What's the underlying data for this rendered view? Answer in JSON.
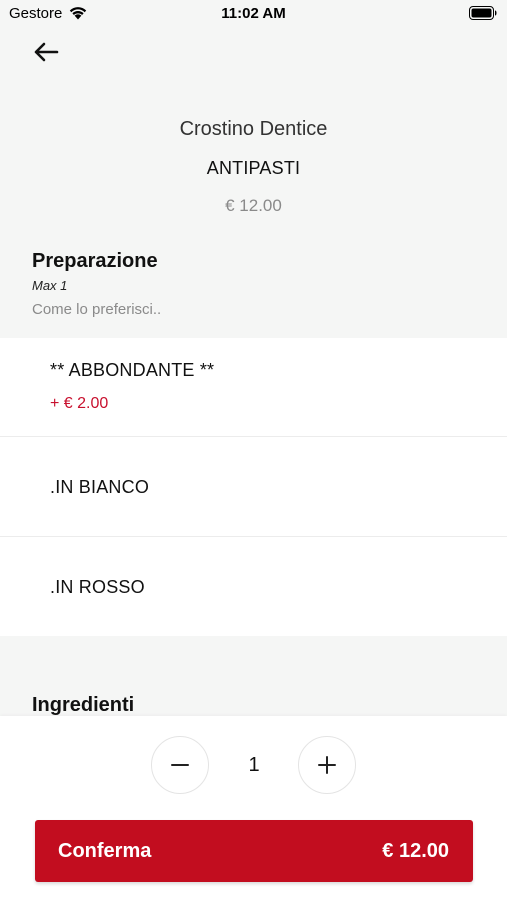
{
  "status_bar": {
    "carrier": "Gestore",
    "time": "11:02 AM",
    "icons": [
      "wifi-icon",
      "battery-icon"
    ]
  },
  "navigation": {
    "back_icon": "arrow-left-icon"
  },
  "product": {
    "name": "Crostino Dentice",
    "category": "ANTIPASTI",
    "price": "€ 12.00"
  },
  "preparation": {
    "title": "Preparazione",
    "max": "Max 1",
    "hint": "Come lo preferisci..",
    "options": [
      {
        "label": "** ABBONDANTE **",
        "extra": "+ € 2.00"
      },
      {
        "label": ".IN BIANCO"
      },
      {
        "label": ".IN ROSSO"
      }
    ]
  },
  "ingredients": {
    "title": "Ingredienti"
  },
  "quantity": {
    "value": "1",
    "minus_icon": "minus-icon",
    "plus_icon": "plus-icon"
  },
  "confirm": {
    "label": "Conferma",
    "total": "€ 12.00"
  },
  "colors": {
    "accent": "#c20d1f",
    "extra_price": "#c8102e",
    "background": "#f5f6f5"
  }
}
